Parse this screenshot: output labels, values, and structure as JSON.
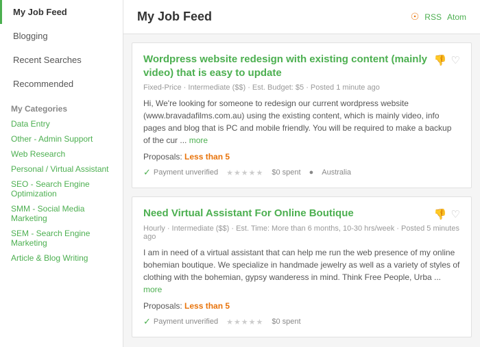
{
  "sidebar": {
    "nav_items": [
      {
        "label": "My Job Feed",
        "active": true
      },
      {
        "label": "Blogging",
        "active": false
      },
      {
        "label": "Recent Searches",
        "active": false
      },
      {
        "label": "Recommended",
        "active": false
      }
    ],
    "categories_title": "My Categories",
    "categories": [
      {
        "label": "Data Entry"
      },
      {
        "label": "Other - Admin Support"
      },
      {
        "label": "Web Research"
      },
      {
        "label": "Personal / Virtual Assistant"
      },
      {
        "label": "SEO - Search Engine Optimization"
      },
      {
        "label": "SMM - Social Media Marketing"
      },
      {
        "label": "SEM - Search Engine Marketing"
      },
      {
        "label": "Article & Blog Writing"
      }
    ]
  },
  "main": {
    "title": "My Job Feed",
    "rss_label": "RSS",
    "atom_label": "Atom",
    "jobs": [
      {
        "title": "Wordpress website redesign with existing content (mainly video) that is easy to update",
        "meta": "Fixed-Price · Intermediate ($$) · Est. Budget: $5 · Posted 1 minute ago",
        "description": "Hi, We're looking for someone to redesign our current wordpress website (www.bravadafilms.com.au) using the existing content, which is mainly video, info pages and blog that is PC and mobile friendly. You will be required to make a backup of the cur ...",
        "more_label": "more",
        "proposals_label": "Proposals:",
        "proposals_value": "Less than 5",
        "client_label": "Payment unverified",
        "spent_label": "$0 spent",
        "location": "Australia"
      },
      {
        "title": "Need Virtual Assistant For Online Boutique",
        "meta": "Hourly · Intermediate ($$) · Est. Time: More than 6 months, 10-30 hrs/week · Posted 5 minutes ago",
        "description": "I am in need of a virtual assistant that can help me run the web presence of my online bohemian boutique. We specialize in handmade jewelry as well as a variety of styles of clothing with the bohemian, gypsy wanderess in mind. Think Free People, Urba ...",
        "more_label": "more",
        "proposals_label": "Proposals:",
        "proposals_value": "Less than 5",
        "client_label": "Payment unverified",
        "spent_label": "$0 spent",
        "location": ""
      }
    ]
  }
}
